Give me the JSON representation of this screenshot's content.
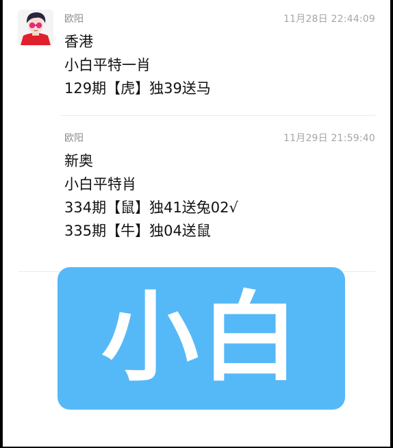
{
  "messages": [
    {
      "sender": "欧阳",
      "time": "11月28日 22:44:09",
      "lines": [
        "香港",
        "小白平特一肖",
        "129期【虎】独39送马"
      ]
    },
    {
      "sender": "欧阳",
      "time": "11月29日 21:59:40",
      "lines": [
        "新奥",
        "小白平特肖",
        "334期【鼠】独41送兔02√",
        "335期【牛】独04送鼠"
      ]
    }
  ],
  "banner": {
    "text": "小白",
    "color": "#56b9f7"
  },
  "avatar": {
    "icon": "user-avatar-icon"
  }
}
